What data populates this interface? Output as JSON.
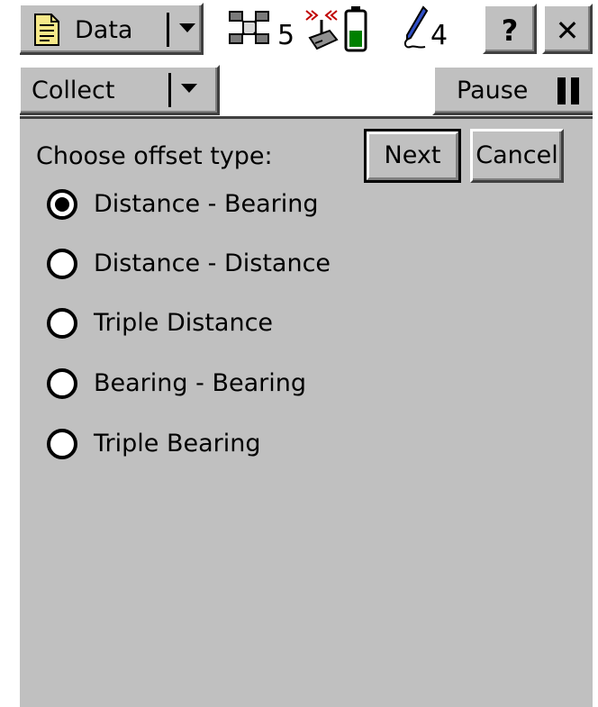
{
  "title_bar": {
    "app_menu_label": "Data",
    "satellite_count": "5",
    "logging_count": "4",
    "help_label": "?",
    "close_label": "✕",
    "battery_level": 0.45,
    "icons": [
      "document-icon",
      "satellite-icon",
      "radio-icon",
      "battery-icon",
      "pen-icon"
    ]
  },
  "toolbar": {
    "mode_label": "Collect",
    "pause_label": "Pause"
  },
  "form": {
    "prompt": "Choose offset type:",
    "next_label": "Next",
    "cancel_label": "Cancel",
    "options": [
      {
        "label": "Distance - Bearing",
        "selected": true
      },
      {
        "label": "Distance - Distance",
        "selected": false
      },
      {
        "label": "Triple Distance",
        "selected": false
      },
      {
        "label": "Bearing - Bearing",
        "selected": false
      },
      {
        "label": "Triple Bearing",
        "selected": false
      }
    ]
  }
}
